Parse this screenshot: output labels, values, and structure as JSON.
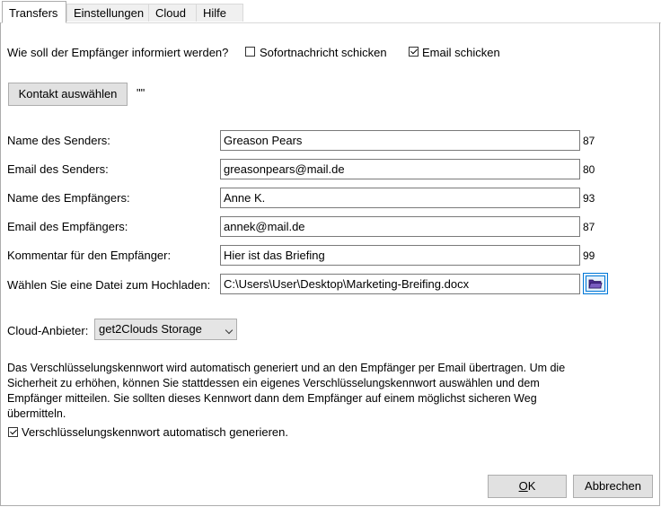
{
  "tabs": [
    {
      "label": "Transfers",
      "active": true
    },
    {
      "label": "Einstellungen",
      "active": false
    },
    {
      "label": "Cloud",
      "active": false
    },
    {
      "label": "Hilfe",
      "active": false
    }
  ],
  "notify": {
    "question": "Wie soll der Empfänger informiert werden?",
    "instant_label": "Sofortnachricht schicken",
    "instant_checked": false,
    "email_label": "Email schicken",
    "email_checked": true
  },
  "contact": {
    "button_label": "Kontakt auswählen",
    "value": "\"\""
  },
  "form": {
    "sender_name": {
      "label": "Name des Senders:",
      "value": "Greason Pears",
      "count": "87"
    },
    "sender_email": {
      "label": "Email des Senders:",
      "value": "greasonpears@mail.de",
      "count": "80"
    },
    "recipient_name": {
      "label": "Name des Empfängers:",
      "value": "Anne K.",
      "count": "93"
    },
    "recipient_email": {
      "label": "Email des Empfängers:",
      "value": "annek@mail.de",
      "count": "87"
    },
    "comment": {
      "label": "Kommentar für den Empfänger:",
      "value": "Hier ist das Briefing",
      "count": "99"
    },
    "file": {
      "label": "Wählen Sie eine Datei zum Hochladen:",
      "value": "C:\\Users\\User\\Desktop\\Marketing-Breifing.docx"
    }
  },
  "cloud": {
    "label": "Cloud-Anbieter:",
    "selected": "get2Clouds Storage"
  },
  "info_text": "Das Verschlüsselungskennwort wird automatisch generiert und an den Empfänger per Email übertragen. Um die Sicherheit zu erhöhen, können Sie stattdessen ein eigenes Verschlüsselungskennwort auswählen und dem Empfänger mitteilen. Sie sollten dieses Kennwort dann dem Empfänger auf einem möglichst sicheren Weg übermitteln.",
  "autogen": {
    "label": "Verschlüsselungskennwort automatisch generieren.",
    "checked": true
  },
  "footer": {
    "ok_label": "OK",
    "cancel_label": "Abbrechen"
  },
  "colors": {
    "folder_icon": "#4a2a8c",
    "focus_blue": "#0078d7",
    "button_face": "#e1e1e1"
  }
}
